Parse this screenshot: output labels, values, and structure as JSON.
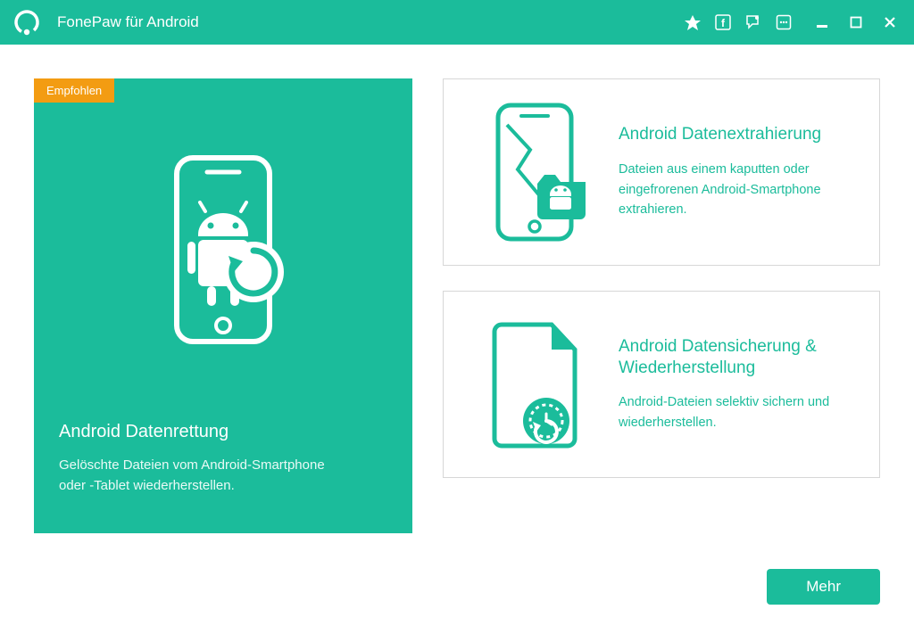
{
  "header": {
    "title": "FonePaw für Android"
  },
  "cards": {
    "recovery": {
      "badge": "Empfohlen",
      "title": "Android Datenrettung",
      "desc": "Gelöschte Dateien vom Android-Smartphone oder -Tablet wiederherstellen."
    },
    "extraction": {
      "title": "Android Datenextrahierung",
      "desc": "Dateien aus einem kaputten oder eingefrorenen Android-Smartphone extrahieren."
    },
    "backup": {
      "title": "Android Datensicherung & Wiederherstellung",
      "desc": "Android-Dateien selektiv sichern und wiederherstellen."
    }
  },
  "footer": {
    "more": "Mehr"
  },
  "colors": {
    "accent": "#1bbc9b",
    "badge": "#f39c12"
  }
}
